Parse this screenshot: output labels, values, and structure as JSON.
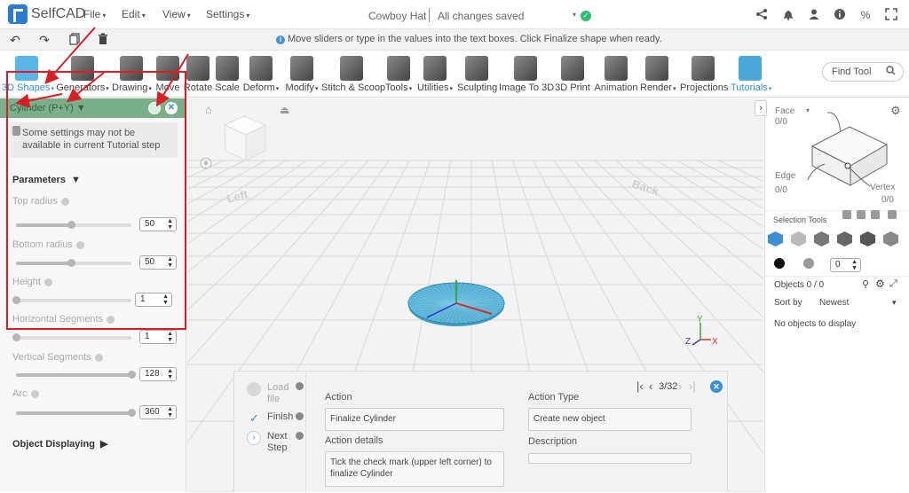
{
  "app": {
    "name": "SelfCAD"
  },
  "menu": [
    "File",
    "Edit",
    "View",
    "Settings"
  ],
  "document": {
    "title": "Cowboy Hat",
    "status": "All changes saved"
  },
  "topbar_icons": [
    "share-icon",
    "bell-icon",
    "user-icon",
    "info-icon",
    "units-icon",
    "fullscreen-icon"
  ],
  "hint": "Move sliders or type in the values into the text boxes. Click Finalize shape when ready.",
  "toolbar": [
    {
      "label": "3D Shapes",
      "has_menu": true,
      "active": true
    },
    {
      "label": "Generators",
      "has_menu": true
    },
    {
      "label": "Drawing",
      "has_menu": true
    },
    {
      "label": "Move"
    },
    {
      "label": "Rotate"
    },
    {
      "label": "Scale"
    },
    {
      "label": "Deform",
      "has_menu": true
    },
    {
      "label": "Modify",
      "has_menu": true
    },
    {
      "label": "Stitch & Scoop"
    },
    {
      "label": "Tools",
      "has_menu": true
    },
    {
      "label": "Utilities",
      "has_menu": true
    },
    {
      "label": "Sculpting"
    },
    {
      "label": "Image To 3D"
    },
    {
      "label": "3D Print"
    },
    {
      "label": "Animation"
    },
    {
      "label": "Render",
      "has_menu": true
    },
    {
      "label": "Projections"
    },
    {
      "label": "Tutorials",
      "has_menu": true,
      "highlight": true
    }
  ],
  "find_tool": {
    "placeholder": "Find Tool"
  },
  "left_panel": {
    "header": "Cylinder (P+Y)",
    "note": "Some settings may not be available in current Tutorial step",
    "parameters_title": "Parameters",
    "params": [
      {
        "label": "Top radius",
        "value": "50",
        "slider_fraction": 0.48
      },
      {
        "label": "Bottom radius",
        "value": "50",
        "slider_fraction": 0.48
      },
      {
        "label": "Height",
        "value": "1",
        "slider_fraction": 0.0
      },
      {
        "label": "Horizontal Segments",
        "value": "1",
        "slider_fraction": 0.0
      },
      {
        "label": "Vertical Segments",
        "value": "128",
        "slider_fraction": 1.0
      },
      {
        "label": "Arc",
        "value": "360",
        "slider_fraction": 1.0
      }
    ],
    "object_displaying": "Object Displaying"
  },
  "viewport": {
    "labels": {
      "left": "Left",
      "back": "Back"
    },
    "axes": {
      "x": "X",
      "y": "Y",
      "z": "Z"
    }
  },
  "tutorial": {
    "steps": [
      {
        "label": "Load file",
        "state": "inactive"
      },
      {
        "label": "Finish",
        "state": "done"
      },
      {
        "label": "Next Step",
        "state": "next"
      }
    ],
    "pager": "3/32",
    "action_label": "Action",
    "action_value": "Finalize Cylinder",
    "action_details_label": "Action details",
    "action_details_value": "Tick the check mark (upper left corner) to finalize Cylinder",
    "action_type_label": "Action Type",
    "action_type_value": "Create new object",
    "description_label": "Description",
    "description_value": ""
  },
  "right_panel": {
    "face_label": "Face",
    "face_count": "0/0",
    "edge_label": "Edge",
    "edge_count": "0/0",
    "vertex_label": "Vertex",
    "vertex_count": "0/0",
    "selection_tools": "Selection Tools",
    "color_value": "0",
    "objects_label": "Objects 0 / 0",
    "sort_label": "Sort by",
    "sort_value": "Newest",
    "empty_text": "No objects to display"
  },
  "colors": {
    "accent": "#3a8fd6",
    "panel_header": "#7aaf8a",
    "annotation_red": "#d81f26",
    "disc": "#4aa3c8",
    "ok_green": "#2ebd6b"
  }
}
